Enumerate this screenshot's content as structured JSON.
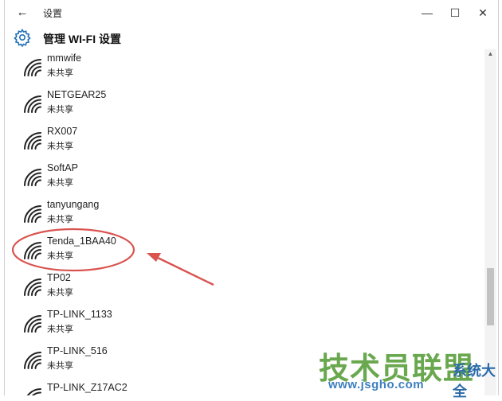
{
  "window": {
    "title": "设置",
    "back_icon": "←",
    "minimize_icon": "—",
    "maximize_icon": "☐",
    "close_icon": "✕"
  },
  "header": {
    "title": "管理 WI-FI 设置",
    "icon": "gear-icon"
  },
  "networks": [
    {
      "ssid": "mmwife",
      "status": "未共享"
    },
    {
      "ssid": "NETGEAR25",
      "status": "未共享"
    },
    {
      "ssid": "RX007",
      "status": "未共享"
    },
    {
      "ssid": "SoftAP",
      "status": "未共享"
    },
    {
      "ssid": "tanyungang",
      "status": "未共享"
    },
    {
      "ssid": "Tenda_1BAA40",
      "status": "未共享"
    },
    {
      "ssid": "TP02",
      "status": "未共享"
    },
    {
      "ssid": "TP-LINK_1133",
      "status": "未共享"
    },
    {
      "ssid": "TP-LINK_516",
      "status": "未共享"
    },
    {
      "ssid": "TP-LINK_Z17AC2",
      "status": ""
    }
  ],
  "annotation": {
    "highlight_color": "#d9534f",
    "highlighted_ssid": "Tenda_1BAA40"
  },
  "watermark": {
    "main": "技术员联盟",
    "sub": "系统大全",
    "url": "www.jsgho.com"
  }
}
